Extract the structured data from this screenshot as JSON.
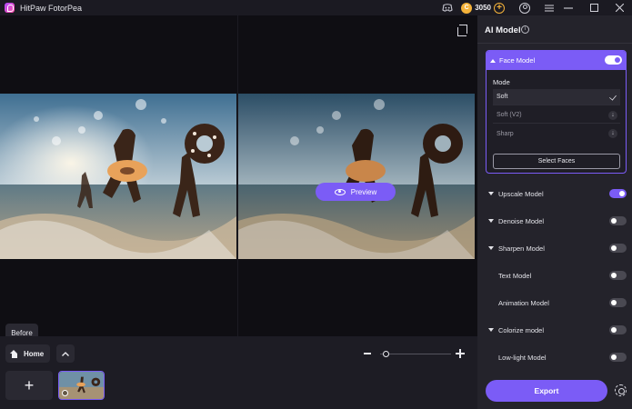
{
  "app": {
    "title": "HitPaw FotorPea"
  },
  "titlebar": {
    "coins": "3050"
  },
  "canvas": {
    "preview_label": "Preview",
    "before_label": "Before"
  },
  "bottom": {
    "home_label": "Home"
  },
  "zoom": {
    "level": 0.05
  },
  "ai_panel": {
    "title": "AI Model",
    "face_model": {
      "label": "Face Model",
      "enabled": true,
      "mode_label": "Mode",
      "modes": [
        {
          "label": "Soft",
          "selected": true,
          "downloadable": false
        },
        {
          "label": "Soft (V2)",
          "selected": false,
          "downloadable": true
        },
        {
          "label": "Sharp",
          "selected": false,
          "downloadable": true
        }
      ],
      "select_faces_label": "Select Faces"
    },
    "models": [
      {
        "label": "Upscale Model",
        "enabled": true
      },
      {
        "label": "Denoise Model",
        "enabled": false
      },
      {
        "label": "Sharpen Model",
        "enabled": false
      },
      {
        "label": "Text Model",
        "enabled": false
      },
      {
        "label": "Animation Model",
        "enabled": false
      },
      {
        "label": "Colorize model",
        "enabled": false
      },
      {
        "label": "Low-light Model",
        "enabled": false
      }
    ],
    "export_label": "Export"
  },
  "colors": {
    "accent": "#7b5cf6",
    "coin": "#f4b23a"
  }
}
